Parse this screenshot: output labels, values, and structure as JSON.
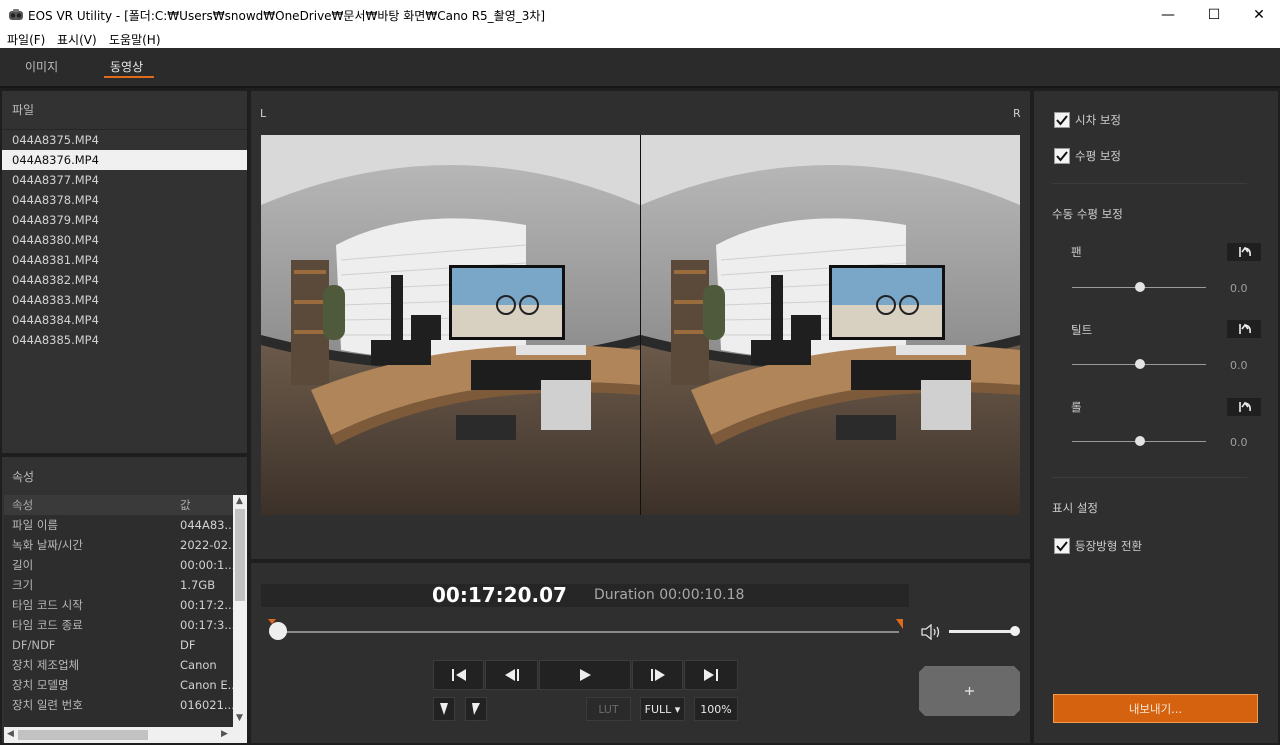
{
  "window": {
    "title": "EOS VR Utility - [폴더:C:₩Users₩snowd₩OneDrive₩문서₩바탕 화면₩Cano R5_촬영_3차]",
    "minimize": "—",
    "maximize": "☐",
    "close": "✕"
  },
  "menu": {
    "file": "파일(F)",
    "view": "표시(V)",
    "help": "도움말(H)"
  },
  "tabs": {
    "image": "이미지",
    "video": "동영상",
    "active": "video"
  },
  "file_panel": {
    "title": "파일",
    "files": [
      "044A8375.MP4",
      "044A8376.MP4",
      "044A8377.MP4",
      "044A8378.MP4",
      "044A8379.MP4",
      "044A8380.MP4",
      "044A8381.MP4",
      "044A8382.MP4",
      "044A8383.MP4",
      "044A8384.MP4",
      "044A8385.MP4"
    ],
    "selected_index": 1
  },
  "properties": {
    "title": "속성",
    "col_key": "속성",
    "col_value": "값",
    "rows": [
      {
        "k": "파일 이름",
        "v": "044A83..."
      },
      {
        "k": "녹화 날짜/시간",
        "v": "2022-02..."
      },
      {
        "k": "길이",
        "v": "00:00:1..."
      },
      {
        "k": "크기",
        "v": "1.7GB"
      },
      {
        "k": "타임 코드 시작",
        "v": "00:17:2..."
      },
      {
        "k": "타임 코드 종료",
        "v": "00:17:3..."
      },
      {
        "k": "DF/NDF",
        "v": "DF"
      },
      {
        "k": "장치 제조업체",
        "v": "Canon"
      },
      {
        "k": "장치 모델명",
        "v": "Canon E..."
      },
      {
        "k": "장치 일련 번호",
        "v": "016021..."
      }
    ]
  },
  "preview": {
    "left_label": "L",
    "right_label": "R"
  },
  "playback": {
    "timecode": "00:17:20.07",
    "duration": "Duration 00:00:10.18",
    "position": 0.0,
    "volume": 1.0,
    "lut": "LUT",
    "full": "FULL ▾",
    "zoom": "100%"
  },
  "adjust": {
    "parallax": "시차 보정",
    "level": "수평 보정",
    "parallax_checked": true,
    "level_checked": true,
    "manual_title": "수동 수평 보정",
    "pan_label": "팬",
    "pan_value": "0.0",
    "tilt_label": "틸트",
    "tilt_value": "0.0",
    "roll_label": "롤",
    "roll_value": "0.0",
    "display_title": "표시 설정",
    "eq_label": "등장방형 전환",
    "eq_checked": true,
    "export": "내보내기..."
  },
  "colors": {
    "accent": "#e06a1c",
    "export_bg": "#d5620e"
  }
}
